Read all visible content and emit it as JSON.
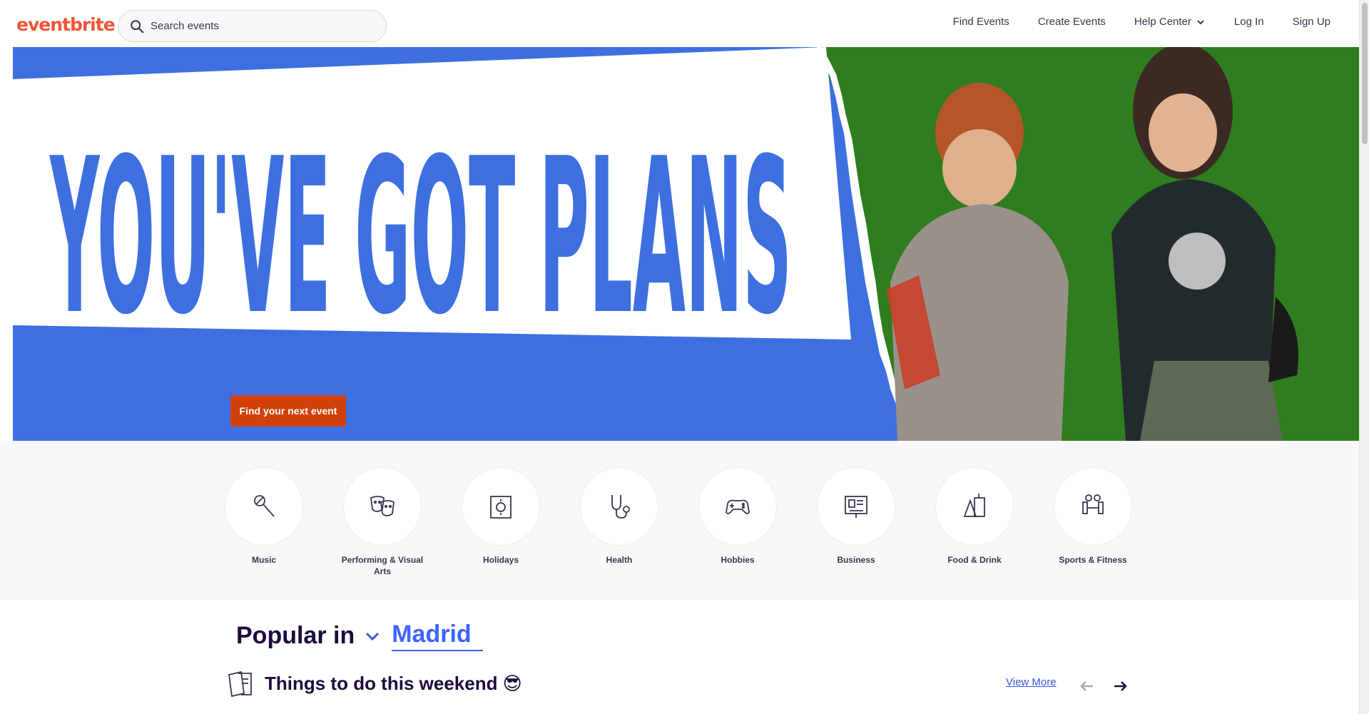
{
  "header": {
    "logo": "eventbrite",
    "search_placeholder": "Search events",
    "nav": {
      "find_events": "Find Events",
      "create_events": "Create Events",
      "help_center": "Help Center",
      "log_in": "Log In",
      "sign_up": "Sign Up"
    }
  },
  "hero": {
    "headline": "YOU'VE GOT PLANS",
    "cta_label": "Find your next event",
    "colors": {
      "blue": "#3d6fe0",
      "green": "#2f7d1e",
      "cta": "#d1410c"
    }
  },
  "categories": [
    {
      "label": "Music",
      "icon": "microphone-icon"
    },
    {
      "label": "Performing & Visual Arts",
      "icon": "theater-masks-icon"
    },
    {
      "label": "Holidays",
      "icon": "calendar-sun-icon"
    },
    {
      "label": "Health",
      "icon": "stethoscope-icon"
    },
    {
      "label": "Hobbies",
      "icon": "gamepad-icon"
    },
    {
      "label": "Business",
      "icon": "presentation-board-icon"
    },
    {
      "label": "Food & Drink",
      "icon": "drinks-icon"
    },
    {
      "label": "Sports & Fitness",
      "icon": "dumbbell-icon"
    }
  ],
  "popular": {
    "label": "Popular in",
    "city": "Madrid"
  },
  "section": {
    "title": "Things to do this weekend 😎",
    "view_more": "View More",
    "icon": "ticket-icon"
  },
  "brand_color": "#f05537",
  "link_color": "#3659e3"
}
